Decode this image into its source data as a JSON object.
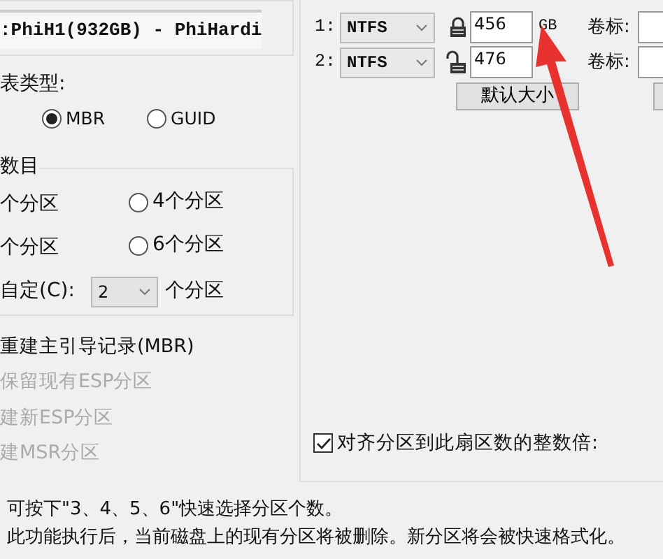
{
  "disk": {
    "value": ":PhiH1(932GB) - PhiHardi"
  },
  "table_type": {
    "label": "表类型:",
    "options": [
      {
        "label": "MBR",
        "selected": true
      },
      {
        "label": "GUID",
        "selected": false
      }
    ]
  },
  "count": {
    "title": "数目",
    "options": [
      {
        "label": "个分区"
      },
      {
        "label": "4个分区",
        "selected": false
      },
      {
        "label": "个分区"
      },
      {
        "label": "6个分区",
        "selected": false
      }
    ],
    "custom": {
      "label": "自定(C):",
      "value": "2",
      "suffix": "个分区"
    }
  },
  "options": [
    {
      "label": "重建主引导记录(MBR)",
      "disabled": false
    },
    {
      "label": "保留现有ESP分区",
      "disabled": true
    },
    {
      "label": "建新ESP分区",
      "disabled": true
    },
    {
      "label": "建MSR分区",
      "disabled": true
    }
  ],
  "partitions": [
    {
      "index": "1:",
      "fs": "NTFS",
      "locked": true,
      "size": "456",
      "unit": "GB",
      "label_caption": "卷标:"
    },
    {
      "index": "2:",
      "fs": "NTFS",
      "locked": false,
      "size": "476",
      "label_caption": "卷标:"
    }
  ],
  "default_size_button": "默认大小",
  "align": {
    "label": "对齐分区到此扇区数的整数倍:",
    "checked": true
  },
  "notes": [
    "可按下\"3、4、5、6\"快速选择分区个数。",
    "此功能执行后，当前磁盘上的现有分区将被删除。新分区将会被快速格式化。"
  ]
}
